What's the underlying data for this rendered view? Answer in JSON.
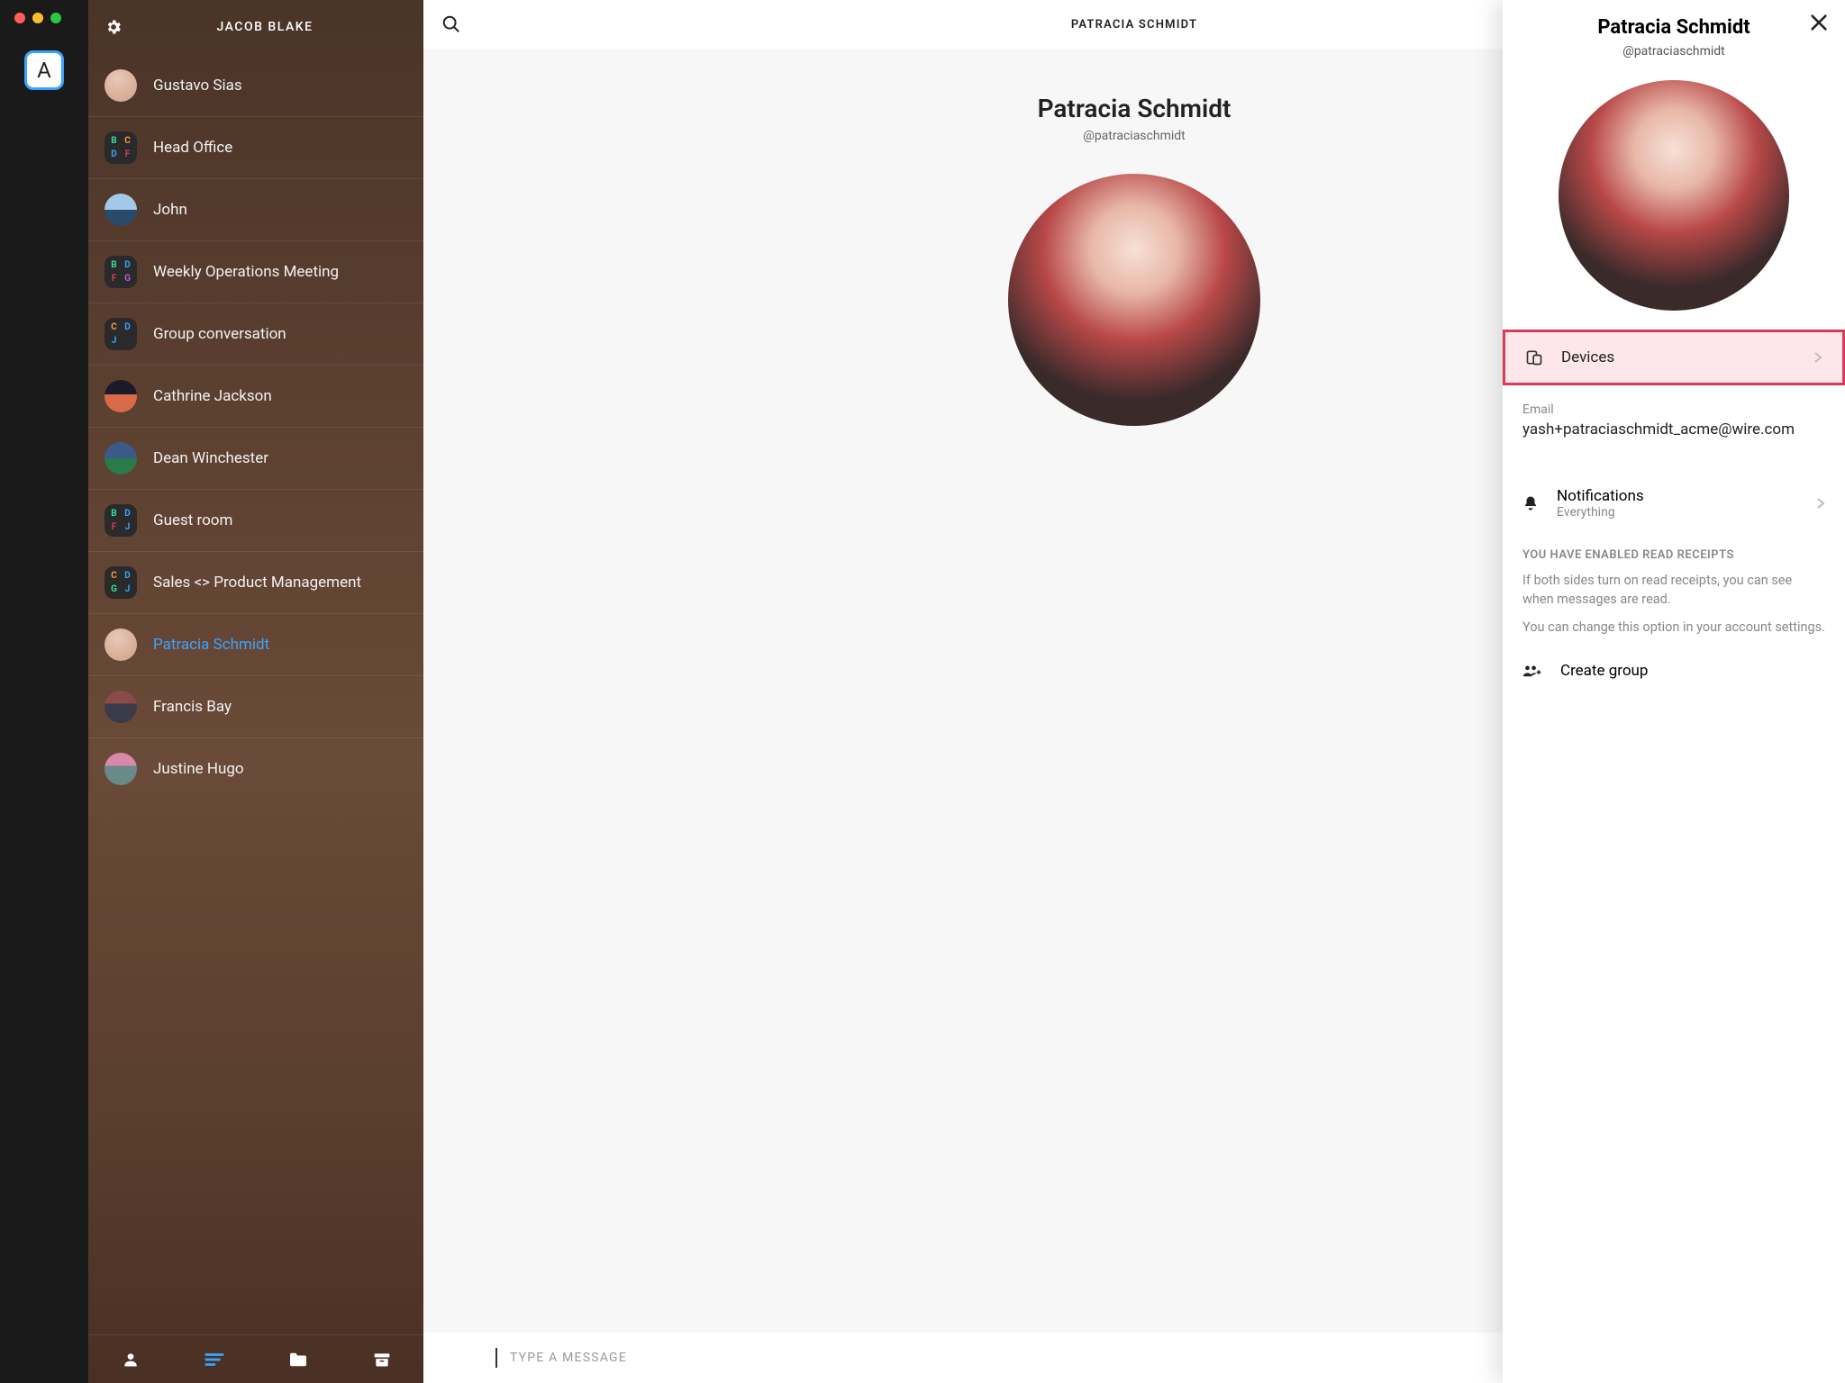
{
  "rail": {
    "workspace_letter": "A"
  },
  "sidebar": {
    "owner": "JACOB BLAKE",
    "items": [
      {
        "label": "Gustavo Sias",
        "kind": "photo"
      },
      {
        "label": "Head Office",
        "kind": "group",
        "letters": [
          "B",
          "C",
          "D",
          "F"
        ],
        "colors": [
          "#3bdc9a",
          "#f7a03c",
          "#3ba3ff",
          "#d83a5a"
        ]
      },
      {
        "label": "John",
        "kind": "land1"
      },
      {
        "label": "Weekly Operations Meeting",
        "kind": "group",
        "letters": [
          "B",
          "D",
          "F",
          "G"
        ],
        "colors": [
          "#3bdc9a",
          "#3ba3ff",
          "#d83a5a",
          "#b85ad8"
        ]
      },
      {
        "label": "Group conversation",
        "kind": "group",
        "letters": [
          "C",
          "D",
          "J",
          ""
        ],
        "colors": [
          "#f7a03c",
          "#3ba3ff",
          "#3ba3ff",
          "#0000"
        ]
      },
      {
        "label": "Cathrine Jackson",
        "kind": "land2"
      },
      {
        "label": "Dean Winchester",
        "kind": "land3"
      },
      {
        "label": "Guest room",
        "kind": "group",
        "letters": [
          "B",
          "D",
          "F",
          "J"
        ],
        "colors": [
          "#3bdc9a",
          "#3ba3ff",
          "#d83a5a",
          "#3ba3ff"
        ]
      },
      {
        "label": "Sales <> Product Management",
        "kind": "group",
        "letters": [
          "C",
          "D",
          "G",
          "J"
        ],
        "colors": [
          "#f7a03c",
          "#3ba3ff",
          "#3bdc9a",
          "#3ba3ff"
        ]
      },
      {
        "label": "Patracia Schmidt",
        "kind": "photo",
        "active": true
      },
      {
        "label": "Francis Bay",
        "kind": "land4"
      },
      {
        "label": "Justine Hugo",
        "kind": "land5"
      }
    ]
  },
  "main": {
    "header_title": "PATRACIA SCHMIDT",
    "contact_name": "Patracia Schmidt",
    "contact_handle": "@patraciaschmidt",
    "compose_placeholder": "TYPE A MESSAGE"
  },
  "panel": {
    "name": "Patracia Schmidt",
    "handle": "@patraciaschmidt",
    "devices_label": "Devices",
    "email_label": "Email",
    "email_value": "yash+patraciaschmidt_acme@wire.com",
    "notifications_label": "Notifications",
    "notifications_value": "Everything",
    "receipts_heading": "YOU HAVE ENABLED READ RECEIPTS",
    "receipts_p1": "If both sides turn on read receipts, you can see when messages are read.",
    "receipts_p2": "You can change this option in your account settings.",
    "create_group_label": "Create group"
  }
}
